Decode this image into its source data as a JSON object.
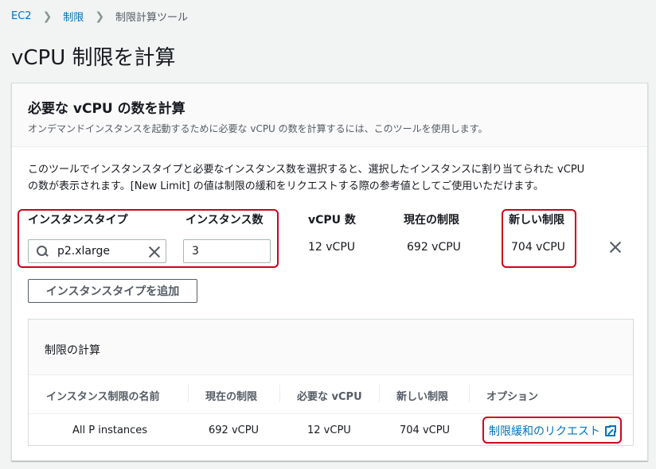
{
  "breadcrumb": {
    "items": [
      "EC2",
      "制限",
      "制限計算ツール"
    ]
  },
  "page": {
    "title": "vCPU 制限を計算"
  },
  "panel": {
    "title": "必要な vCPU の数を計算",
    "description": "オンデマンドインスタンスを起動するために必要な vCPU の数を計算するには、このツールを使用します。",
    "intro_line1": "このツールでインスタンスタイプと必要なインスタンス数を選択すると、選択したインスタンスに割り当てられた vCPU",
    "intro_line2": "の数が表示されます。[New Limit] の値は制限の緩和をリクエストする際の参考値としてご使用いただけます。"
  },
  "calculator": {
    "labels": {
      "instance_type": "インスタンスタイプ",
      "instance_count": "インスタンス数",
      "vcpu_count": "vCPU 数",
      "current_limit": "現在の制限",
      "new_limit": "新しい制限"
    },
    "row": {
      "instance_type_value": "p2.xlarge",
      "instance_count_value": "3",
      "vcpu_count": "12 vCPU",
      "current_limit": "692 vCPU",
      "new_limit": "704 vCPU"
    },
    "add_button": "インスタンスタイプを追加"
  },
  "limit_calc": {
    "title": "制限の計算",
    "columns": [
      "インスタンス制限の名前",
      "現在の制限",
      "必要な vCPU",
      "新しい制限",
      "オプション"
    ],
    "rows": [
      {
        "name": "All P instances",
        "current": "692 vCPU",
        "required": "12 vCPU",
        "new": "704 vCPU",
        "option": "制限緩和のリクエスト"
      }
    ]
  },
  "icons": {
    "search": "search-icon",
    "clear": "close-icon",
    "remove_row": "close-icon",
    "external_link": "external-link-icon"
  },
  "colors": {
    "link": "#0073bb",
    "highlight": "#d0021b"
  }
}
